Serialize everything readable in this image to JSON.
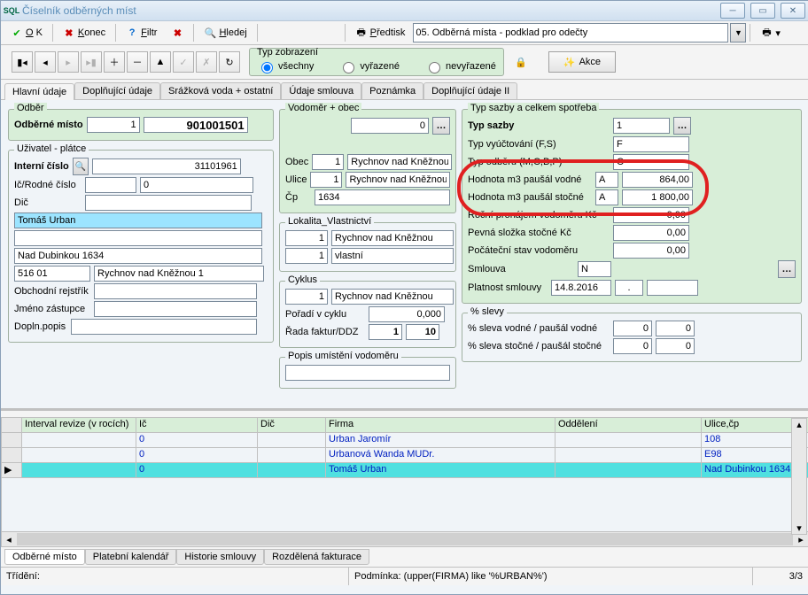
{
  "window": {
    "title": "Číselník odběrných míst"
  },
  "toolbar": {
    "ok": "OK",
    "konec": "Konec",
    "filtr": "Filtr",
    "hledej": "Hledej",
    "predtisk": "Předtisk",
    "predtisk_value": "05. Odběrná místa - podklad pro odečty",
    "akce": "Akce"
  },
  "display_type": {
    "legend": "Typ zobrazení",
    "all": "všechny",
    "discarded": "vyřazené",
    "active": "nevyřazené"
  },
  "tabs": {
    "t1": "Hlavní údaje",
    "t2": "Doplňující údaje",
    "t3": "Srážková voda + ostatní",
    "t4": "Údaje smlouva",
    "t5": "Poznámka",
    "t6": "Doplňující údaje II"
  },
  "odber": {
    "legend": "Odběr",
    "label": "Odběrné místo",
    "val1": "1",
    "val2": "901001501"
  },
  "uzivatel": {
    "legend": "Uživatel - plátce",
    "interni_cislo_lbl": "Interní číslo",
    "interni_cislo": "31101961",
    "ic_rodne_lbl": "Ič/Rodné číslo",
    "ic_rodne": "0",
    "dic_lbl": "Dič",
    "dic": "",
    "jmeno": "Tomáš Urban",
    "blank1": "",
    "adresa1": "Nad Dubinkou 1634",
    "psc": "516 01",
    "mesto": "Rychnov nad Kněžnou 1",
    "obch_rejstrik_lbl": "Obchodní rejstřík",
    "obch_rejstrik": "",
    "jmeno_zastupce_lbl": "Jméno zástupce",
    "jmeno_zastupce": "",
    "dopln_popis_lbl": "Dopln.popis",
    "dopln_popis": ""
  },
  "vodomer_obec": {
    "legend": "Vodoměr + obec",
    "val": "0",
    "obec_lbl": "Obec",
    "obec_n": "1",
    "obec_t": "Rychnov nad Kněžnou",
    "ulice_lbl": "Ulice",
    "ulice_n": "1",
    "ulice_t": "Rychnov nad Kněžnou",
    "cp_lbl": "Čp",
    "cp": "1634"
  },
  "lokalita": {
    "legend": "Lokalita_Vlastnictví",
    "r1n": "1",
    "r1t": "Rychnov nad Kněžnou",
    "r2n": "1",
    "r2t": "vlastní"
  },
  "cyklus": {
    "legend": "Cyklus",
    "n": "1",
    "t": "Rychnov nad Kněžnou",
    "poradi_lbl": "Pořadí v cyklu",
    "poradi": "0,000",
    "rada_lbl": "Řada faktur/DDZ",
    "rada1": "1",
    "rada2": "10"
  },
  "popis_umist": {
    "legend": "Popis umístění vodoměru",
    "val": ""
  },
  "sazba": {
    "legend": "Typ sazby a celkem spotřeba",
    "typ_sazby_lbl": "Typ sazby",
    "typ_sazby": "1",
    "typ_vyuct_lbl": "Typ vyúčtování (F,S)",
    "typ_vyuct": "F",
    "typ_odberu_lbl": "Typ odběru (M,C,B,P)",
    "typ_odberu": "C",
    "hodn_vodne_lbl": "Hodnota m3 paušál vodné",
    "hodn_vodne_kod": "A",
    "hodn_vodne": "864,00",
    "hodn_stocne_lbl": "Hodnota m3 paušál stočné",
    "hodn_stocne_kod": "A",
    "hodn_stocne": "1 800,00",
    "rocni_pronajem_lbl": "Roční pronájem vodoměru Kč",
    "rocni_pronajem": "0,00",
    "pevna_slozka_lbl": "Pevná složka stočné Kč",
    "pevna_slozka": "0,00",
    "pocatecni_stav_lbl": "Počáteční stav vodoměru",
    "pocatecni_stav": "0,00",
    "smlouva_lbl": "Smlouva",
    "smlouva": "N",
    "platnost_lbl": "Platnost smlouvy",
    "platnost": "14.8.2016",
    "platnost2": "."
  },
  "slevy": {
    "legend": "% slevy",
    "vodne_lbl": "% sleva vodné / paušál vodné",
    "vodne1": "0",
    "vodne2": "0",
    "stocne_lbl": "% sleva stočné / paušál stočné",
    "stocne1": "0",
    "stocne2": "0"
  },
  "grid": {
    "cols": {
      "c1": "Interval revize (v rocích)",
      "c2": "Ič",
      "c3": "Dič",
      "c4": "Firma",
      "c5": "Oddělení",
      "c6": "Ulice,čp"
    },
    "rows": [
      {
        "c1": "",
        "c2": "0",
        "c3": "",
        "c4": "Urban Jaromír",
        "c5": "",
        "c6": "108"
      },
      {
        "c1": "",
        "c2": "0",
        "c3": "",
        "c4": "Urbanová Wanda MUDr.",
        "c5": "",
        "c6": "E98"
      },
      {
        "c1": "",
        "c2": "0",
        "c3": "",
        "c4": "Tomáš Urban",
        "c5": "",
        "c6": "Nad Dubinkou 1634"
      }
    ]
  },
  "bottom_tabs": {
    "b1": "Odběrné místo",
    "b2": "Platební kalendář",
    "b3": "Historie smlouvy",
    "b4": "Rozdělená fakturace"
  },
  "status": {
    "trideni": "Třídění:",
    "podminka": "Podmínka: (upper(FIRMA) like '%URBAN%')",
    "pos": "3/3"
  }
}
